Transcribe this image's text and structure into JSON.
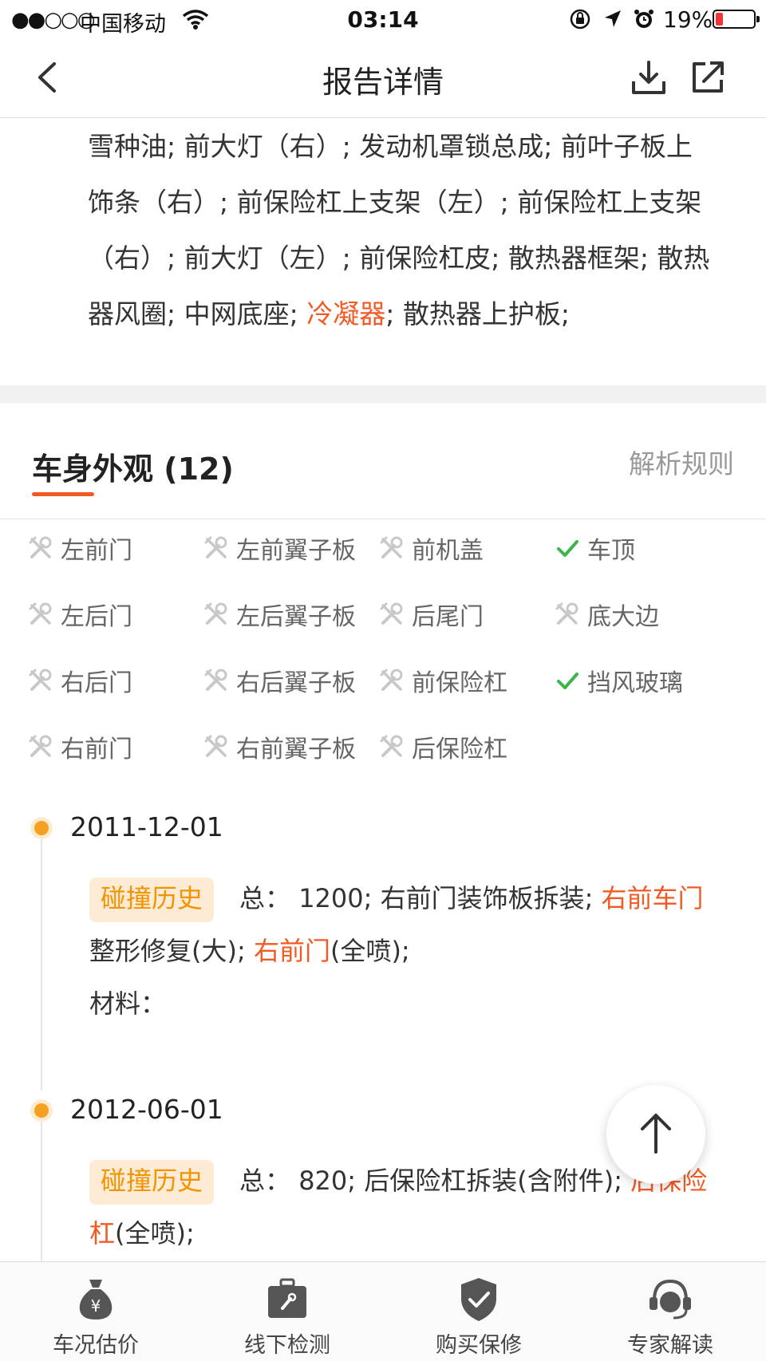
{
  "status_bar": {
    "signal": "●●○○○",
    "carrier": "中国移动",
    "time": "03:14",
    "battery_text": "19%",
    "battery_level": 0.19,
    "battery_color": "#f2353a"
  },
  "nav": {
    "title": "报告详情",
    "icons": [
      "back-icon",
      "download-icon",
      "share-icon"
    ]
  },
  "parts_paragraph": {
    "before": "雪种油; 前大灯（右）; 发动机罩锁总成; 前叶子板上饰条（右）; 前保险杠上支架（左）; 前保险杠上支架（右）; 前大灯（左）; 前保险杠皮; 散热器框架; 散热器风圈; 中网底座; ",
    "highlight": "冷凝器",
    "after": "; 散热器上护板;"
  },
  "section": {
    "title": "车身外观 (12)",
    "rules_link": "解析规则"
  },
  "body_parts": [
    {
      "label": "左前门",
      "status": "repair"
    },
    {
      "label": "左前翼子板",
      "status": "repair"
    },
    {
      "label": "前机盖",
      "status": "repair"
    },
    {
      "label": "车顶",
      "status": "ok"
    },
    {
      "label": "左后门",
      "status": "repair"
    },
    {
      "label": "左后翼子板",
      "status": "repair"
    },
    {
      "label": "后尾门",
      "status": "repair"
    },
    {
      "label": "底大边",
      "status": "repair"
    },
    {
      "label": "右后门",
      "status": "repair"
    },
    {
      "label": "右后翼子板",
      "status": "repair"
    },
    {
      "label": "前保险杠",
      "status": "repair"
    },
    {
      "label": "挡风玻璃",
      "status": "ok"
    },
    {
      "label": "右前门",
      "status": "repair"
    },
    {
      "label": "右前翼子板",
      "status": "repair"
    },
    {
      "label": "后保险杠",
      "status": "repair"
    }
  ],
  "records": [
    {
      "date": "2011-12-01",
      "tag": "碰撞历史",
      "t1": "总：  1200; 右前门装饰板拆装; ",
      "h1": "右前车门",
      "t2": "整形修复(大); ",
      "h2": "右前门",
      "t3": "(全喷);",
      "material": "材料："
    },
    {
      "date": "2012-06-01",
      "tag": "碰撞历史",
      "t1": "总：  820; 后保险杠拆装(含附件); ",
      "h1": "后保险杠",
      "t2": "(全喷);"
    }
  ],
  "tabs": [
    {
      "label": "车况估价",
      "icon": "money-bag-icon"
    },
    {
      "label": "线下检测",
      "icon": "toolbox-icon"
    },
    {
      "label": "购买保修",
      "icon": "shield-check-icon"
    },
    {
      "label": "专家解读",
      "icon": "headset-icon"
    }
  ],
  "colors": {
    "accent": "#f15a24",
    "tag_text": "#f29300",
    "tag_bg": "#fdebd5",
    "ok_check": "#3cb44b",
    "repair_icon": "#c8c8c8"
  }
}
